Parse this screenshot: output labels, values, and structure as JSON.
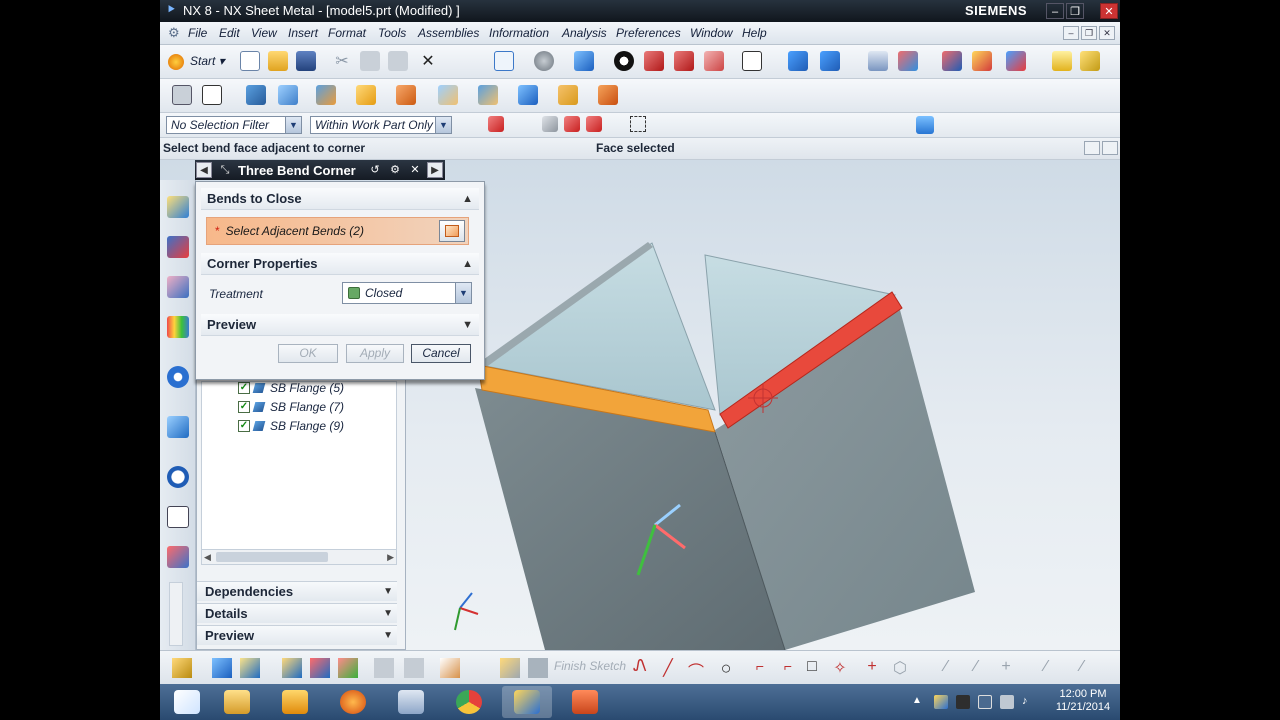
{
  "window": {
    "title": "NX 8 - NX Sheet Metal - [model5.prt (Modified) ]",
    "brand": "SIEMENS"
  },
  "menu": [
    "File",
    "Edit",
    "View",
    "Insert",
    "Format",
    "Tools",
    "Assemblies",
    "Information",
    "Analysis",
    "Preferences",
    "Window",
    "Help"
  ],
  "toolbar": {
    "start_label": "Start"
  },
  "selection_filter": {
    "filter_value": "No Selection Filter",
    "scope_value": "Within Work Part Only"
  },
  "status": {
    "prompt": "Select bend face adjacent to corner",
    "message": "Face selected"
  },
  "dialog": {
    "title": "Three Bend Corner",
    "group_bends": "Bends to Close",
    "select_label": "Select Adjacent Bends (2)",
    "group_corner": "Corner Properties",
    "treatment_label": "Treatment",
    "treatment_value": "Closed",
    "group_preview": "Preview",
    "ok": "OK",
    "apply": "Apply",
    "cancel": "Cancel"
  },
  "navigator": {
    "items": [
      "SB Flange (5)",
      "SB Flange (7)",
      "SB Flange (9)"
    ],
    "sections": [
      "Dependencies",
      "Details",
      "Preview"
    ]
  },
  "bottom_toolbar": {
    "finish_sketch": "Finish Sketch"
  },
  "taskbar": {
    "time": "12:00 PM",
    "date": "11/21/2014"
  },
  "colors": {
    "selected_bend": "#f2a43a",
    "highlight_bend": "#e8493c",
    "panel_face": "#bcd5dc",
    "side_face": "#7f8d92"
  }
}
